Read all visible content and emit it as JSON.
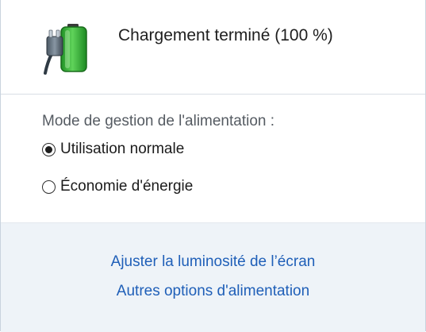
{
  "status": {
    "icon": "battery-charging-plug-icon",
    "text": "Chargement terminé (100 %)"
  },
  "power_plan": {
    "title": "Mode de gestion de l'alimentation :",
    "options": [
      {
        "label": "Utilisation normale",
        "selected": true
      },
      {
        "label": "Économie d'énergie",
        "selected": false
      }
    ]
  },
  "links": {
    "brightness": "Ajuster la luminosité de l’écran",
    "power_options": "Autres options d'alimentation"
  },
  "colors": {
    "link": "#1f5fb8",
    "battery_green": "#2fb52f",
    "links_band_bg": "#eef3f8"
  }
}
